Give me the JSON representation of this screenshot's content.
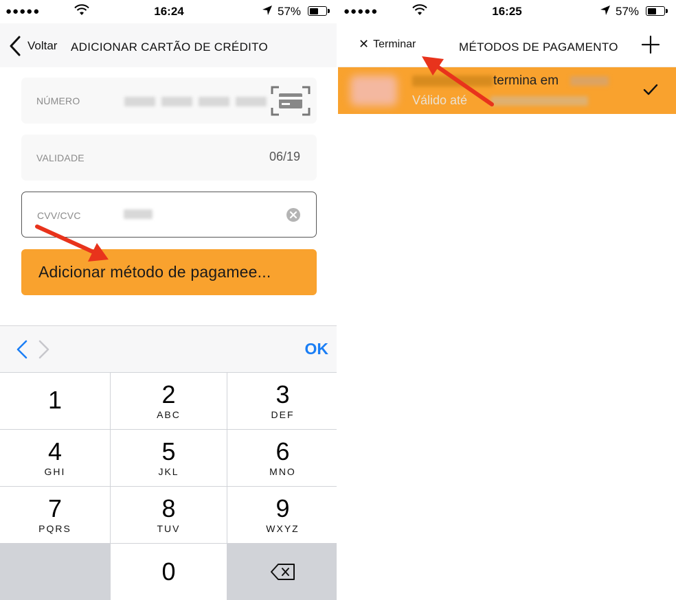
{
  "left": {
    "status": {
      "dots": "●●●●●",
      "time": "16:24",
      "battery": "57%"
    },
    "nav": {
      "back_label": "Voltar",
      "title": "ADICIONAR CARTÃO DE CRÉDITO"
    },
    "form": {
      "number_label": "NÚMERO",
      "validity_label": "VALIDADE",
      "validity_value": "06/19",
      "cvv_label": "CVV/CVC",
      "submit_label": "Adicionar método de pagamee..."
    },
    "accessory": {
      "ok_label": "OK"
    },
    "keypad": {
      "keys": [
        {
          "num": "1",
          "letters": ""
        },
        {
          "num": "2",
          "letters": "ABC"
        },
        {
          "num": "3",
          "letters": "DEF"
        },
        {
          "num": "4",
          "letters": "GHI"
        },
        {
          "num": "5",
          "letters": "JKL"
        },
        {
          "num": "6",
          "letters": "MNO"
        },
        {
          "num": "7",
          "letters": "PQRS"
        },
        {
          "num": "8",
          "letters": "TUV"
        },
        {
          "num": "9",
          "letters": "WXYZ"
        },
        {
          "num": "0",
          "letters": ""
        }
      ]
    }
  },
  "right": {
    "status": {
      "dots": "●●●●●",
      "time": "16:25",
      "battery": "57%"
    },
    "nav": {
      "close_glyph": "✕",
      "done_label": "Terminar",
      "title": "MÉTODOS DE PAGAMENTO"
    },
    "card": {
      "line1": "termina em",
      "line2": "Válido até"
    }
  },
  "colors": {
    "accent": "#f9a22e",
    "link": "#1a7ef5",
    "arrow": "#e8331c"
  }
}
